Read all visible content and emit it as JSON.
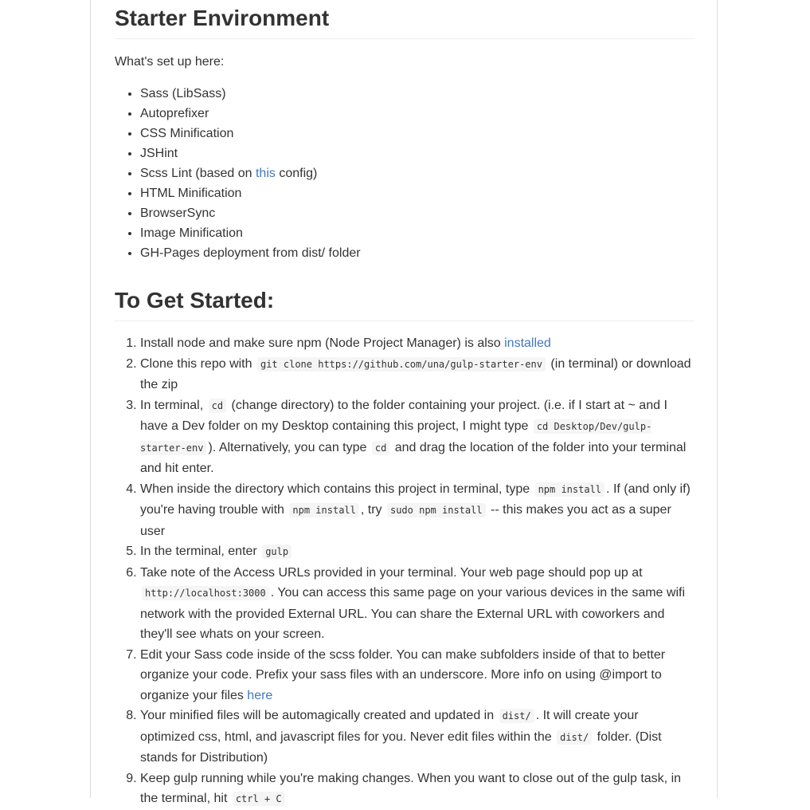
{
  "section_env": {
    "title": "Starter Environment",
    "intro": "What's set up here:",
    "items": [
      {
        "text": "Sass (LibSass)"
      },
      {
        "text": "Autoprefixer"
      },
      {
        "text": "CSS Minification"
      },
      {
        "text": "JSHint"
      },
      {
        "before": "Scss Lint (based on ",
        "link": "this",
        "after": " config)"
      },
      {
        "text": "HTML Minification"
      },
      {
        "text": "BrowserSync"
      },
      {
        "text": "Image Minification"
      },
      {
        "text": "GH-Pages deployment from dist/ folder"
      }
    ]
  },
  "section_start": {
    "title": "To Get Started:",
    "steps": [
      {
        "t1": "Install node and make sure npm (Node Project Manager) is also ",
        "link": "installed"
      },
      {
        "t1": "Clone this repo with ",
        "c1": "git clone https://github.com/una/gulp-starter-env",
        "t2": " (in terminal) or download the zip"
      },
      {
        "t1": "In terminal, ",
        "c1": "cd",
        "t2": " (change directory) to the folder containing your project. (i.e. if I start at ~ and I have a Dev folder on my Desktop containing this project, I might type ",
        "c2": "cd Desktop/Dev/gulp-starter-env",
        "t3": "). Alternatively, you can type ",
        "c3": "cd",
        "t4": " and drag the location of the folder into your terminal and hit enter."
      },
      {
        "t1": "When inside the directory which contains this project in terminal, type ",
        "c1": "npm install",
        "t2": ". If (and only if) you're having trouble with ",
        "c2": "npm install",
        "t3": ", try ",
        "c3": "sudo npm install",
        "t4": " -- this makes you act as a super user"
      },
      {
        "t1": "In the terminal, enter ",
        "c1": "gulp"
      },
      {
        "t1": "Take note of the Access URLs provided in your terminal. Your web page should pop up at ",
        "c1": "http://localhost:3000",
        "t2": ". You can access this same page on your various devices in the same wifi network with the provided External URL. You can share the External URL with coworkers and they'll see whats on your screen."
      },
      {
        "t1": "Edit your Sass code inside of the scss folder. You can make subfolders inside of that to better organize your code. Prefix your sass files with an underscore. More info on using @import to organize your files ",
        "link": "here"
      },
      {
        "t1": "Your minified files will be automagically created and updated in ",
        "c1": "dist/",
        "t2": ". It will create your optimized css, html, and javascript files for you. Never edit files within the ",
        "c2": "dist/",
        "t3": " folder. (Dist stands for Distribution)"
      },
      {
        "t1": "Keep gulp running while you're making changes. When you want to close out of the gulp task, in the terminal, hit ",
        "c1": "ctrl + C"
      }
    ]
  },
  "colors": {
    "link": "#4078c0",
    "text": "#333333"
  }
}
